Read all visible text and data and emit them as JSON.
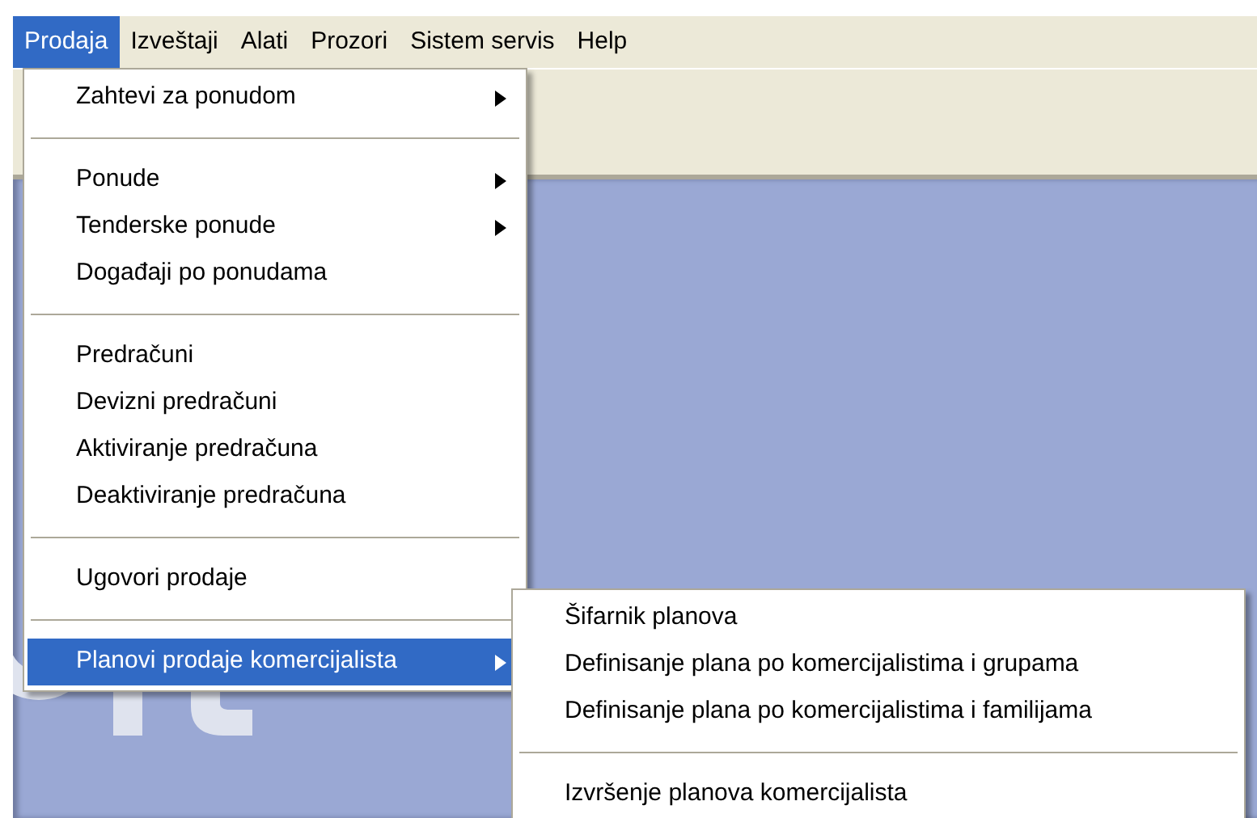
{
  "menubar": [
    {
      "label": "Prodaja",
      "selected": true
    },
    {
      "label": "Izveštaji",
      "selected": false
    },
    {
      "label": "Alati",
      "selected": false
    },
    {
      "label": "Prozori",
      "selected": false
    },
    {
      "label": "Sistem servis",
      "selected": false
    },
    {
      "label": "Help",
      "selected": false
    }
  ],
  "menu": {
    "items": [
      {
        "kind": "item",
        "label": "Zahtevi za ponudom",
        "submenu": true,
        "selected": false
      },
      {
        "kind": "separator"
      },
      {
        "kind": "item",
        "label": "Ponude",
        "submenu": true,
        "selected": false
      },
      {
        "kind": "item",
        "label": "Tenderske ponude",
        "submenu": true,
        "selected": false
      },
      {
        "kind": "item",
        "label": "Događaji po ponudama",
        "submenu": false,
        "selected": false
      },
      {
        "kind": "separator"
      },
      {
        "kind": "item",
        "label": "Predračuni",
        "submenu": false,
        "selected": false
      },
      {
        "kind": "item",
        "label": "Devizni predračuni",
        "submenu": false,
        "selected": false
      },
      {
        "kind": "item",
        "label": "Aktiviranje predračuna",
        "submenu": false,
        "selected": false
      },
      {
        "kind": "item",
        "label": "Deaktiviranje predračuna",
        "submenu": false,
        "selected": false
      },
      {
        "kind": "separator"
      },
      {
        "kind": "item",
        "label": "Ugovori prodaje",
        "submenu": false,
        "selected": false
      },
      {
        "kind": "separator"
      },
      {
        "kind": "item",
        "label": "Planovi prodaje komercijalista",
        "submenu": true,
        "selected": true
      }
    ]
  },
  "submenu": {
    "items": [
      {
        "kind": "item",
        "label": "Šifarnik planova",
        "submenu": false,
        "selected": false
      },
      {
        "kind": "item",
        "label": "Definisanje plana po komercijalistima i grupama",
        "submenu": false,
        "selected": false
      },
      {
        "kind": "item",
        "label": "Definisanje plana po komercijalistima i familijama",
        "submenu": false,
        "selected": false
      },
      {
        "kind": "separator"
      },
      {
        "kind": "item",
        "label": "Izvršenje planova komercijalista",
        "submenu": false,
        "selected": false
      }
    ]
  }
}
